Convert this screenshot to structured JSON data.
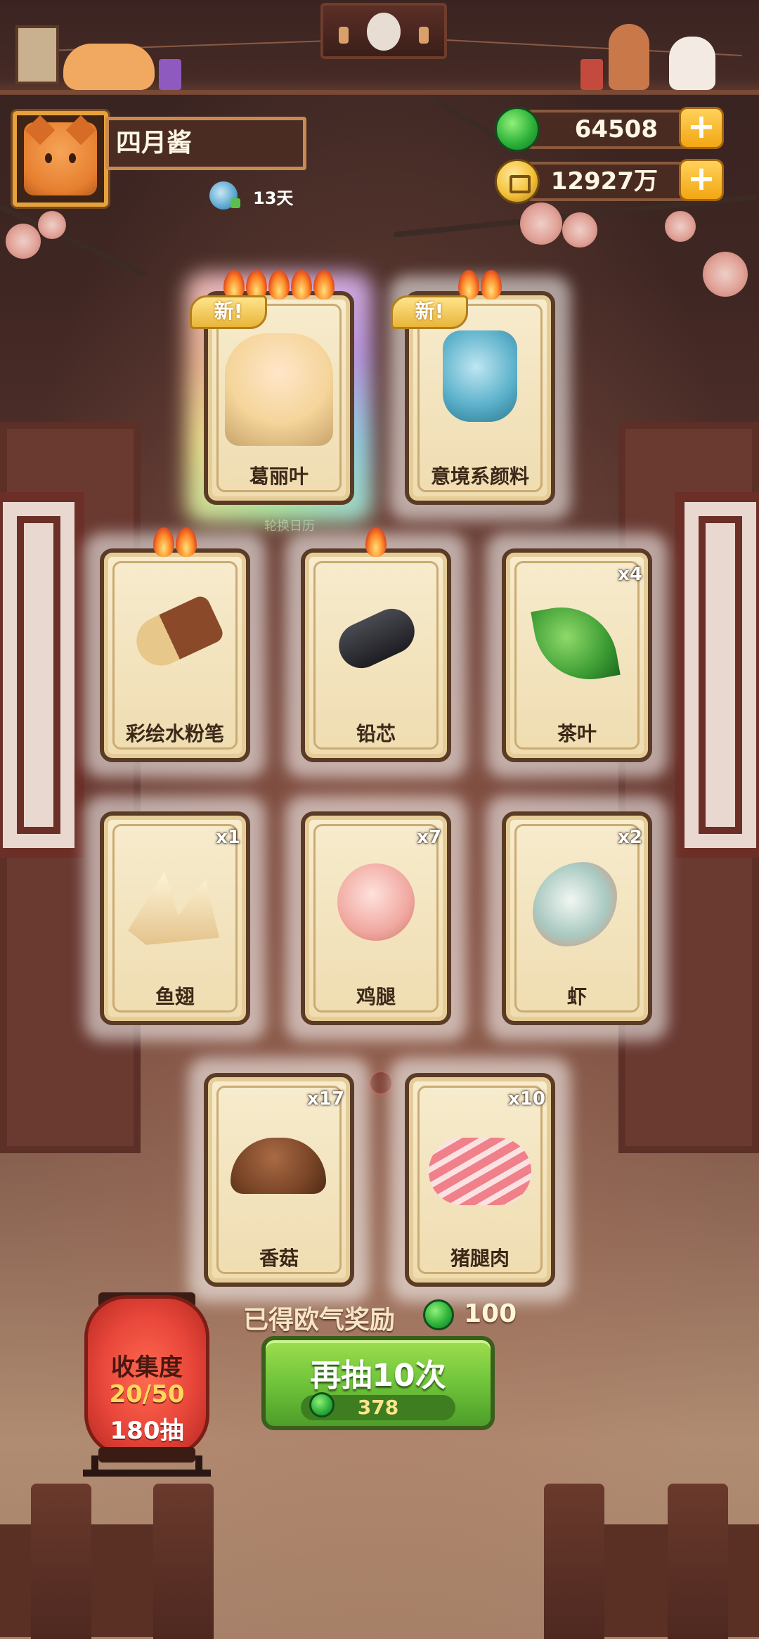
{
  "player": {
    "name": "四月酱",
    "days": "13天"
  },
  "currency": {
    "gems": "64508",
    "coins": "12927万",
    "add_label": "+"
  },
  "calendar_label": "轮换日历",
  "cards": [
    {
      "name": "葛丽叶",
      "count": "",
      "flames": 5,
      "is_new": true,
      "new_label": "新!"
    },
    {
      "name": "意境系颜料",
      "count": "",
      "flames": 2,
      "is_new": true,
      "new_label": "新!"
    },
    {
      "name": "彩绘水粉笔",
      "count": "",
      "flames": 2,
      "is_new": false
    },
    {
      "name": "铅芯",
      "count": "",
      "flames": 1,
      "is_new": false
    },
    {
      "name": "茶叶",
      "count": "x4",
      "flames": 0,
      "is_new": false
    },
    {
      "name": "鱼翅",
      "count": "x1",
      "flames": 0,
      "is_new": false
    },
    {
      "name": "鸡腿",
      "count": "x7",
      "flames": 0,
      "is_new": false
    },
    {
      "name": "虾",
      "count": "x2",
      "flames": 0,
      "is_new": false
    },
    {
      "name": "香菇",
      "count": "x17",
      "flames": 0,
      "is_new": false
    },
    {
      "name": "猪腿肉",
      "count": "x10",
      "flames": 0,
      "is_new": false
    }
  ],
  "reward": {
    "label": "已得欧气奖励",
    "amount": "100"
  },
  "draw_button": {
    "label": "再抽10次",
    "cost": "378"
  },
  "collection": {
    "title": "收集度",
    "progress": "20/50",
    "pulls": "180抽"
  },
  "colors": {
    "background": "#3a2420",
    "card_bg": "#f3e4bf",
    "card_border": "#5a3b26",
    "draw_button": "#6fc43a",
    "lantern": "#e8463a",
    "flame": "#ff8a2a"
  }
}
